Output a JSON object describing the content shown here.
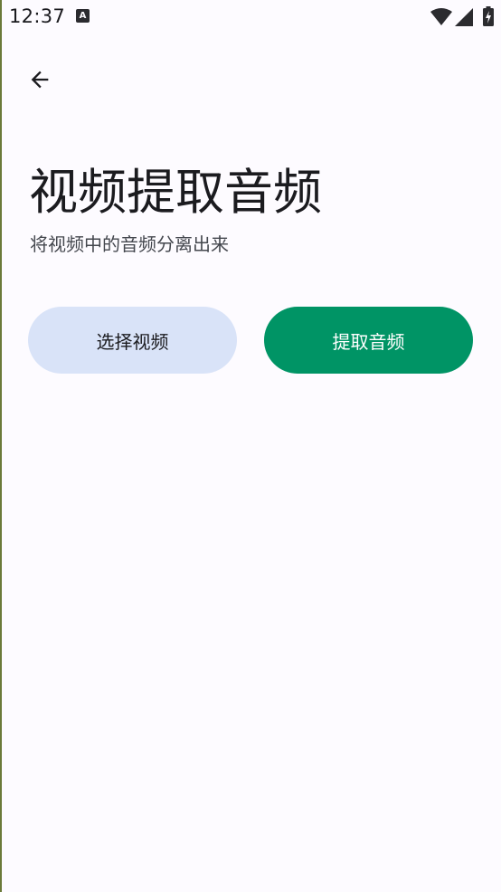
{
  "status_bar": {
    "time": "12:37",
    "notification_glyph": "A",
    "icons": [
      "wifi-icon",
      "cell-signal-icon",
      "battery-charging-icon"
    ]
  },
  "toolbar": {
    "back_icon": "arrow-left-icon"
  },
  "header": {
    "title": "视频提取音频",
    "subtitle": "将视频中的音频分离出来"
  },
  "actions": {
    "select_label": "选择视频",
    "extract_label": "提取音频"
  },
  "colors": {
    "background": "#fdfbff",
    "select_button_bg": "#d9e3f8",
    "extract_button_bg": "#009465",
    "text_primary": "#1b1b1f"
  }
}
